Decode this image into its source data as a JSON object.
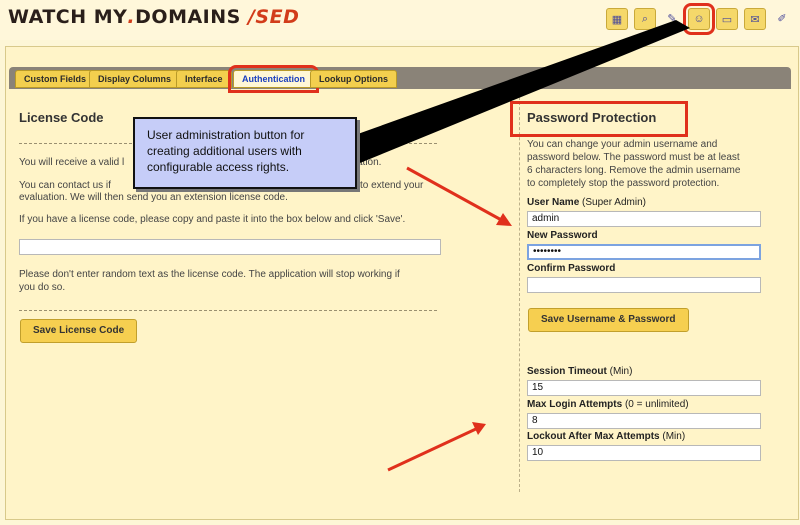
{
  "brand": {
    "logo_main": "WATCH MY",
    "logo_dot": ".",
    "logo_rest": "DOMAINS",
    "logo_sep": "/",
    "logo_suffix": "SED"
  },
  "toolbar": {
    "icons": [
      "overview-icon",
      "search-icon",
      "tools-icon",
      "users-icon",
      "folder-icon",
      "mail-icon",
      "pencil-icon"
    ]
  },
  "tabs": [
    {
      "label": "Custom Fields"
    },
    {
      "label": "Display Columns"
    },
    {
      "label": "Interface"
    },
    {
      "label": "Authentication"
    },
    {
      "label": "Lookup Options"
    }
  ],
  "license": {
    "title": "License Code",
    "line1": "You will receive a valid l",
    "line1_end": "ation.",
    "line2a": "You can contact us if",
    "line2a_end": "to extend your",
    "line2b": "evaluation. We will then send you an extension license code.",
    "line3": "If you have a license code, please copy and paste it into the box below and click 'Save'.",
    "input_value": "",
    "warning1": "Please don't enter random text as the license code. The application will stop working if",
    "warning2": "you do so.",
    "save_label": "Save License Code"
  },
  "callout": {
    "text": "User administration button for creating additional users with configurable access rights."
  },
  "password": {
    "title": "Password Protection",
    "desc1": "You can change your admin username and",
    "desc2": "password below. The password must be at least",
    "desc3": "6 characters long. Remove the admin username",
    "desc4": "to completely stop the password protection.",
    "username_label": "User Name",
    "username_hint": "(Super Admin)",
    "username_value": "admin",
    "newpass_label": "New Password",
    "newpass_value": "••••••••",
    "confirm_label": "Confirm Password",
    "confirm_value": "",
    "save_label": "Save Username & Password"
  },
  "session": {
    "timeout_label": "Session Timeout",
    "timeout_hint": "(Min)",
    "timeout_value": "15",
    "maxlogin_label": "Max Login Attempts",
    "maxlogin_hint": "(0 = unlimited)",
    "maxlogin_value": "8",
    "lockout_label": "Lockout After Max Attempts",
    "lockout_hint": "(Min)",
    "lockout_value": "10"
  },
  "colors": {
    "accent": "#e0301c",
    "tab": "#f3cf4e",
    "active_tab_text": "#1a3fbf",
    "callout_bg": "#c6cdf8",
    "panel_bg": "#fff4c8"
  }
}
